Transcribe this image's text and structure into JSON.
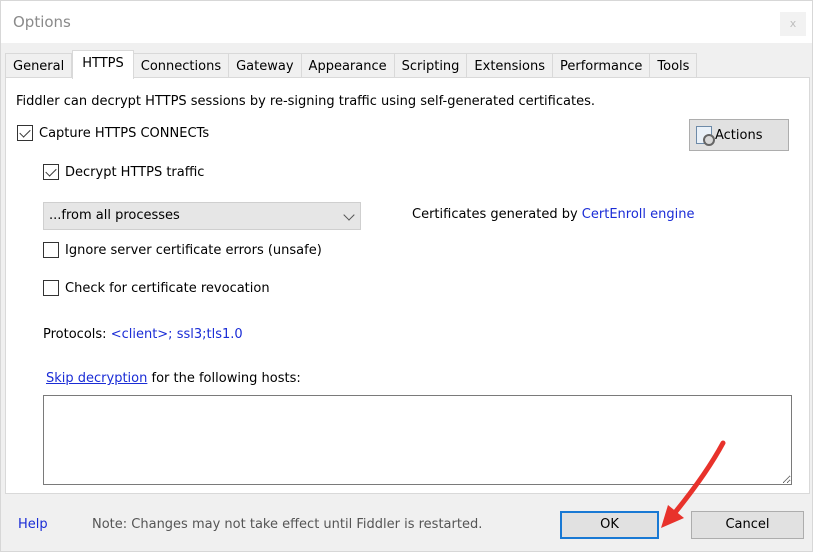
{
  "window": {
    "title": "Options",
    "close_glyph": "x"
  },
  "tabs": [
    {
      "label": "General",
      "active": false
    },
    {
      "label": "HTTPS",
      "active": true
    },
    {
      "label": "Connections",
      "active": false
    },
    {
      "label": "Gateway",
      "active": false
    },
    {
      "label": "Appearance",
      "active": false
    },
    {
      "label": "Scripting",
      "active": false
    },
    {
      "label": "Extensions",
      "active": false
    },
    {
      "label": "Performance",
      "active": false
    },
    {
      "label": "Tools",
      "active": false
    }
  ],
  "https": {
    "description": "Fiddler can decrypt HTTPS sessions by re-signing traffic using self-generated certificates.",
    "capture_connects": {
      "label": "Capture HTTPS CONNECTs",
      "checked": true
    },
    "decrypt_traffic": {
      "label": "Decrypt HTTPS traffic",
      "checked": true
    },
    "process_filter": {
      "selected": "...from all processes"
    },
    "actions_label": "Actions",
    "certs_prefix": "Certificates generated by ",
    "certs_engine": "CertEnroll engine",
    "ignore_errors": {
      "label": "Ignore server certificate errors (unsafe)",
      "checked": false
    },
    "check_revocation": {
      "label": "Check for certificate revocation",
      "checked": false
    },
    "protocols_prefix": "Protocols: ",
    "protocols_value": "<client>; ssl3;tls1.0",
    "skip_link": "Skip decryption",
    "skip_suffix": " for the following hosts:",
    "hosts_value": ""
  },
  "footer": {
    "help_label": "Help",
    "note": "Note: Changes may not take effect until Fiddler is restarted.",
    "ok_label": "OK",
    "cancel_label": "Cancel"
  },
  "colors": {
    "link": "#1a2cd6",
    "ok_focus_border": "#1979d4",
    "annotation_arrow": "#e8322b"
  },
  "icons": {
    "actions": "certificate-gear-icon",
    "dropdown": "chevron-down-icon",
    "annotation": "red-arrow-icon"
  }
}
